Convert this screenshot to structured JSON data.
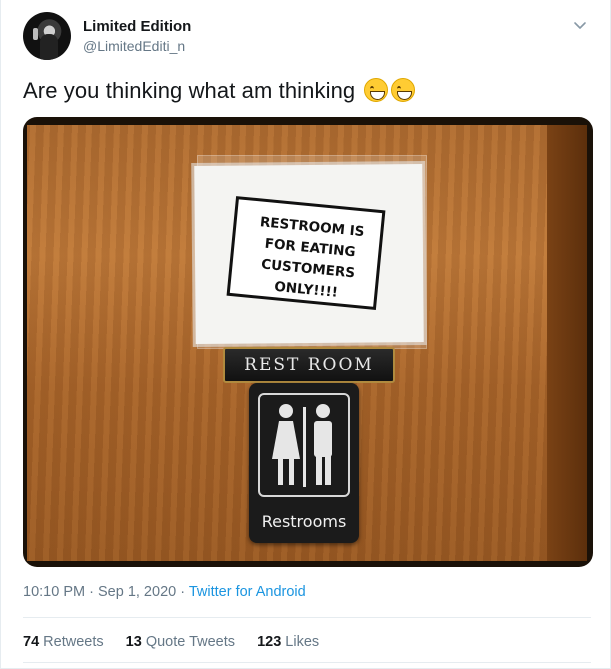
{
  "author": {
    "name": "Limited Edition",
    "handle": "@LimitedEditi_n"
  },
  "tweet": {
    "text": "Are you thinking what am thinking",
    "emoji": [
      "grinning-face-with-smiling-eyes",
      "grinning-face-with-smiling-eyes"
    ]
  },
  "image": {
    "sign_lines": [
      "RESTROOM IS",
      "FOR EATING",
      "CUSTOMERS",
      "ONLY!!!!"
    ],
    "plate": "REST ROOM",
    "restroom_label": "Restrooms"
  },
  "meta": {
    "time": "10:10 PM",
    "separator": "·",
    "date": "Sep 1, 2020",
    "source": "Twitter for Android"
  },
  "stats": {
    "retweets_count": "74",
    "retweets_label": "Retweets",
    "quotes_count": "13",
    "quotes_label": "Quote Tweets",
    "likes_count": "123",
    "likes_label": "Likes"
  },
  "colors": {
    "link": "#1b95e0",
    "secondary_text": "#657786",
    "primary_text": "#14171a"
  }
}
